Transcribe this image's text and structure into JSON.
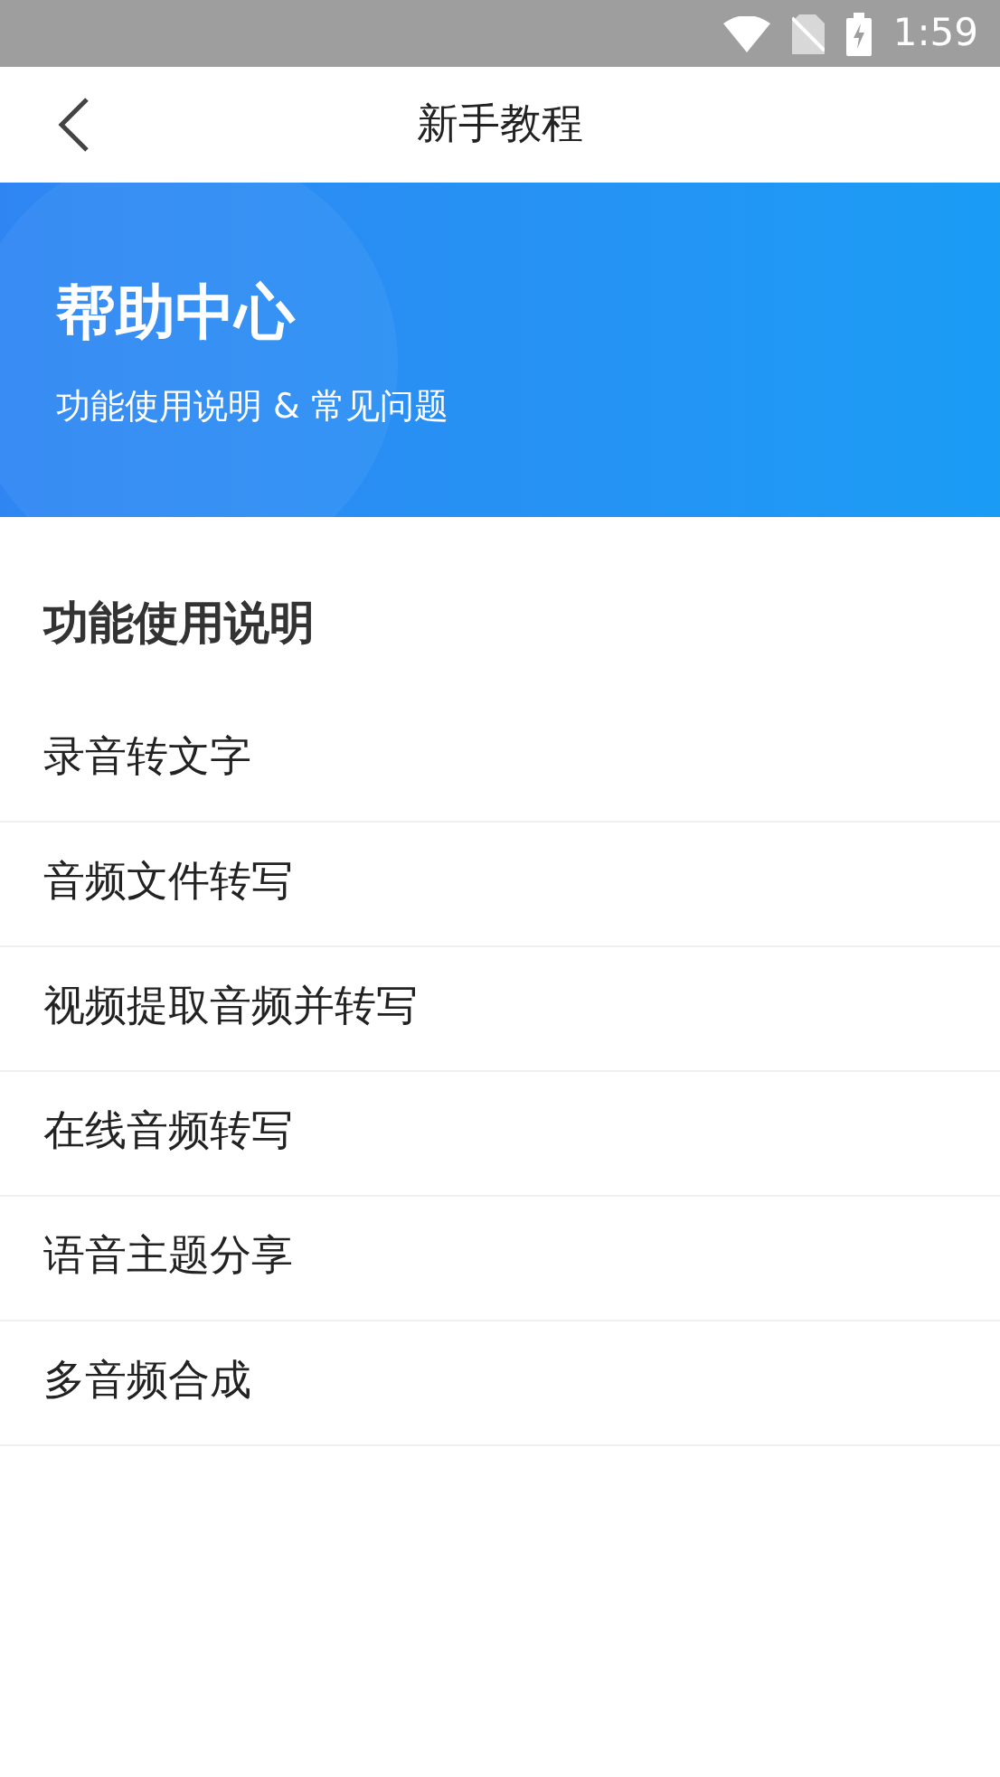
{
  "status_bar": {
    "time": "1:59"
  },
  "header": {
    "title": "新手教程"
  },
  "banner": {
    "title": "帮助中心",
    "subtitle": "功能使用说明 & 常见问题"
  },
  "section": {
    "title": "功能使用说明",
    "items": [
      {
        "label": "录音转文字"
      },
      {
        "label": "音频文件转写"
      },
      {
        "label": "视频提取音频并转写"
      },
      {
        "label": "在线音频转写"
      },
      {
        "label": "语音主题分享"
      },
      {
        "label": "多音频合成"
      }
    ]
  }
}
